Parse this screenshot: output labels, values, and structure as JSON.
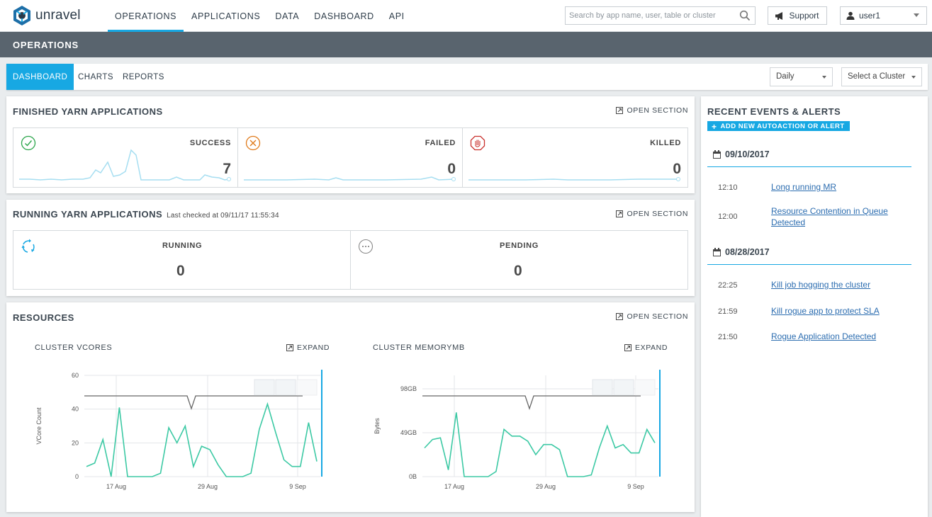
{
  "app": {
    "name": "unravel"
  },
  "nav": {
    "items": [
      "OPERATIONS",
      "APPLICATIONS",
      "DATA",
      "DASHBOARD",
      "API"
    ],
    "active": "OPERATIONS"
  },
  "search": {
    "placeholder": "Search by app name, user, table or cluster"
  },
  "support": {
    "label": "Support"
  },
  "user": {
    "name": "user1"
  },
  "page": {
    "title": "OPERATIONS"
  },
  "subtabs": {
    "items": [
      "DASHBOARD",
      "CHARTS",
      "REPORTS"
    ],
    "active": "DASHBOARD"
  },
  "filters": {
    "period": "Daily",
    "cluster": "Select a Cluster"
  },
  "finished": {
    "title": "FINISHED YARN APPLICATIONS",
    "open_section": "OPEN SECTION",
    "tiles": [
      {
        "label": "SUCCESS",
        "value": "7",
        "icon": "check-circle-icon",
        "color": "#2aa54a"
      },
      {
        "label": "FAILED",
        "value": "0",
        "icon": "x-circle-icon",
        "color": "#e07b1c"
      },
      {
        "label": "KILLED",
        "value": "0",
        "icon": "stop-hand-icon",
        "color": "#c9302c"
      }
    ],
    "sparkline_color": "#a6def1"
  },
  "running": {
    "title": "RUNNING YARN APPLICATIONS",
    "last_checked": "Last checked at 09/11/17 11:55:34",
    "open_section": "OPEN SECTION",
    "tiles": [
      {
        "label": "RUNNING",
        "value": "0",
        "icon": "running-arrows-icon"
      },
      {
        "label": "PENDING",
        "value": "0",
        "icon": "pending-dots-icon"
      }
    ]
  },
  "resources": {
    "title": "RESOURCES",
    "open_section": "OPEN SECTION",
    "expand_label": "EXPAND"
  },
  "chart_data": [
    {
      "type": "line",
      "title": "CLUSTER VCORES",
      "ylabel": "VCore Count",
      "ylim": [
        0,
        60
      ],
      "yticks": [
        "0",
        "20",
        "40",
        "60"
      ],
      "xticks": [
        "17 Aug",
        "29 Aug",
        "9 Sep"
      ],
      "grid": true,
      "color": "#3cc9a4",
      "threshold_color": "#666666",
      "values": [
        6,
        8,
        22,
        0,
        41,
        0,
        0,
        0,
        0,
        2,
        29,
        20,
        30,
        6,
        18,
        16,
        7,
        0,
        0,
        0,
        2,
        28,
        43,
        26,
        10,
        6,
        6,
        32,
        9
      ]
    },
    {
      "type": "line",
      "title": "CLUSTER MEMORYMB",
      "ylabel": "Bytes",
      "yticks": [
        "0B",
        "49GB",
        "98GB"
      ],
      "xticks": [
        "17 Aug",
        "29 Aug",
        "9 Sep"
      ],
      "grid": true,
      "color": "#3cc9a4",
      "threshold_color": "#666666",
      "values": [
        17,
        22,
        23,
        4,
        38,
        0,
        0,
        0,
        0,
        3,
        28,
        24,
        24,
        21,
        13,
        19,
        19,
        16,
        0,
        0,
        0,
        1,
        17,
        30,
        17,
        19,
        14,
        14,
        28,
        20
      ]
    }
  ],
  "events": {
    "title": "RECENT EVENTS & ALERTS",
    "add_label": "ADD NEW AUTOACTION OR ALERT",
    "groups": [
      {
        "date": "09/10/2017",
        "items": [
          {
            "time": "12:10",
            "text": "Long running MR"
          },
          {
            "time": "12:00",
            "text": "Resource Contention in Queue Detected"
          }
        ]
      },
      {
        "date": "08/28/2017",
        "items": [
          {
            "time": "22:25",
            "text": "Kill job hogging the cluster"
          },
          {
            "time": "21:59",
            "text": "Kill rogue app to protect SLA"
          },
          {
            "time": "21:50",
            "text": "Rogue Application Detected"
          }
        ]
      }
    ]
  },
  "colors": {
    "accent": "#17a8e3",
    "header_bg": "#59646e",
    "link": "#2c6db0"
  }
}
